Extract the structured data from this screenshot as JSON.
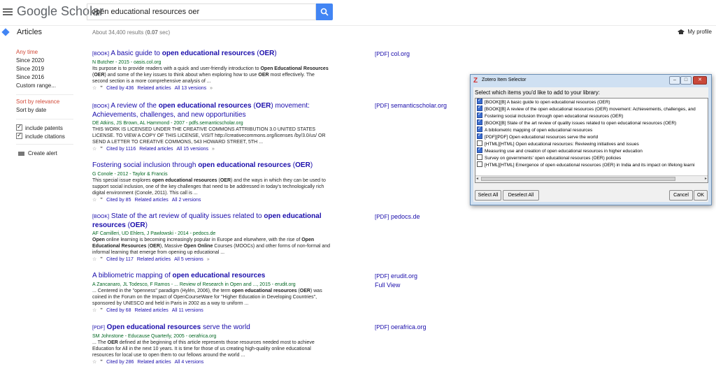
{
  "header": {
    "logo": "Google Scholar",
    "search_value": "open educational resources oer"
  },
  "subheader": {
    "section": "Articles",
    "result_count": "About 34,400 results (",
    "result_time": "0.07",
    "result_sec": " sec)",
    "profile": "My profile"
  },
  "sidebar": {
    "time_filters": [
      "Any time",
      "Since 2020",
      "Since 2019",
      "Since 2016",
      "Custom range..."
    ],
    "sort": [
      "Sort by relevance",
      "Sort by date"
    ],
    "checks": [
      "include patents",
      "include citations"
    ],
    "create_alert": "Create alert"
  },
  "results": [
    {
      "tag": "[BOOK]",
      "title_pre": " A basic guide to ",
      "title_bold": "open educational resources",
      "title_post": " (",
      "title_bold2": "OER",
      "title_end": ")",
      "meta": "N Butcher - 2015 - oasis.col.org",
      "snippet": "Its purpose is to provide readers with a quick and user-friendly introduction to Open Educational Resources (OER) and some of the key issues to think about when exploring how to use OER most effectively. The second section is a more comprehensive analysis of ...",
      "cited": "Cited by 436",
      "related": "Related articles",
      "versions": "All 13 versions",
      "pdf_tag": "[PDF]",
      "pdf_src": "col.org"
    },
    {
      "tag": "[BOOK]",
      "title_pre": " A review of the ",
      "title_bold": "open educational resources",
      "title_post": " (",
      "title_bold2": "OER",
      "title_end": ") movement: Achievements, challenges, and new opportunities",
      "meta": "DE Atkins, JS Brown, AL Hammond - 2007 - pdfs.semanticscholar.org",
      "snippet": "THIS WORK IS LICENSED UNDER THE CREATIVE COMMONS ATTRIBUTION 3.0 UNITED STATES LICENSE. TO VIEW A COPY OF THIS LICENSE, VISIT http://creativecommons.org/licenses /by/3.0/us/ OR SEND A LETTER TO CREATIVE COMMONS, 543 HOWARD STREET, 5TH ...",
      "cited": "Cited by 1116",
      "related": "Related articles",
      "versions": "All 15 versions",
      "pdf_tag": "[PDF]",
      "pdf_src": "semanticscholar.org"
    },
    {
      "tag": "",
      "title_pre": "Fostering social inclusion through ",
      "title_bold": "open educational resources",
      "title_post": " (",
      "title_bold2": "OER",
      "title_end": ")",
      "meta": "G Conole - 2012 - Taylor & Francis",
      "snippet": "This special issue explores open educational resources (OER) and the ways in which they can be used to support social inclusion, one of the key challenges that need to be addressed in today's technologically rich digital environment (Conole, 2011). This call is ...",
      "cited": "Cited by 85",
      "related": "Related articles",
      "versions": "All 2 versions",
      "pdf_tag": "",
      "pdf_src": ""
    },
    {
      "tag": "[BOOK]",
      "title_pre": " State of the art review of quality issues related to ",
      "title_bold": "open educational resources",
      "title_post": " (",
      "title_bold2": "OER",
      "title_end": ")",
      "meta": "AF Camilleri, UD Ehlers, J Pawlowski - 2014 - pedocs.de",
      "snippet": "Open online learning is becoming increasingly popular in Europe and elsewhere, with the rise of Open Educational Resources (OER), Massive Open Online Courses (MOOCs) and other forms of non-formal and informal learning that emerge from opening up educational ...",
      "cited": "Cited by 117",
      "related": "Related articles",
      "versions": "All 5 versions",
      "pdf_tag": "[PDF]",
      "pdf_src": "pedocs.de"
    },
    {
      "tag": "",
      "title_pre": "A bibliometric mapping of ",
      "title_bold": "open educational resources",
      "title_post": "",
      "title_bold2": "",
      "title_end": "",
      "meta": "A Zancanaro, JL Todesco, F Ramos - ... Review of Research in Open and ..., 2015 - erudit.org",
      "snippet": "... Centered in the \"openness\" paradigm (Hylén, 2006), the term open educational resources (OER) was coined in the Forum on the Impact of OpenCourseWare for \"Higher Education in Developing Countries\", sponsored by UNESCO and held in Paris in 2002 as a way to uniform ...",
      "cited": "Cited by 68",
      "related": "Related articles",
      "versions": "All 11 versions",
      "pdf_tag": "[PDF]",
      "pdf_src": "erudit.org",
      "full_view": "Full View"
    },
    {
      "tag": "[PDF]",
      "title_pre": " ",
      "title_bold": "Open educational resources",
      "title_post": " serve the world",
      "title_bold2": "",
      "title_end": "",
      "meta": "SM Johnstone - Educause Quarterly, 2005 - oerafrica.org",
      "snippet": "... The OER defined at the beginning of this article represents those resources needed most to achieve Education for All in the next 10 years. It is time for those of us creating high-quality online educational resources for local use to open them to our fellows around the world ...",
      "cited": "Cited by 286",
      "related": "Related articles",
      "versions": "All 4 versions",
      "pdf_tag": "[PDF]",
      "pdf_src": "oerafrica.org"
    }
  ],
  "zotero": {
    "title": "Zotero Item Selector",
    "prompt": "Select which items you'd like to add to your library:",
    "items": [
      {
        "label": "[BOOK][B] A basic guide to open educational resources (OER)",
        "checked": true
      },
      {
        "label": "[BOOK][B] A review of the open educational resources (OER) movement: Achievements, challenges, and",
        "checked": true
      },
      {
        "label": "Fostering social inclusion through open educational resources (OER)",
        "checked": true
      },
      {
        "label": "[BOOK][B] State of the art review of quality issues related to open educational resources (OER)",
        "checked": true
      },
      {
        "label": "A bibliometric mapping of open educational resources",
        "checked": true
      },
      {
        "label": "[PDF][PDF] Open educational resources serve the world",
        "checked": true
      },
      {
        "label": "[HTML][HTML] Open educational resources: Reviewing initiatives and issues",
        "checked": false
      },
      {
        "label": "Measuring use and creation of open educational resources in higher education",
        "checked": true
      },
      {
        "label": "Survey on governments' open educational resources (OER) policies",
        "checked": false
      },
      {
        "label": "[HTML][HTML] Emergence of open educational resources (OER) in India and its impact on lifelong learni",
        "checked": false
      }
    ],
    "select_all": "Select All",
    "deselect_all": "Deselect All",
    "cancel": "Cancel",
    "ok": "OK"
  }
}
